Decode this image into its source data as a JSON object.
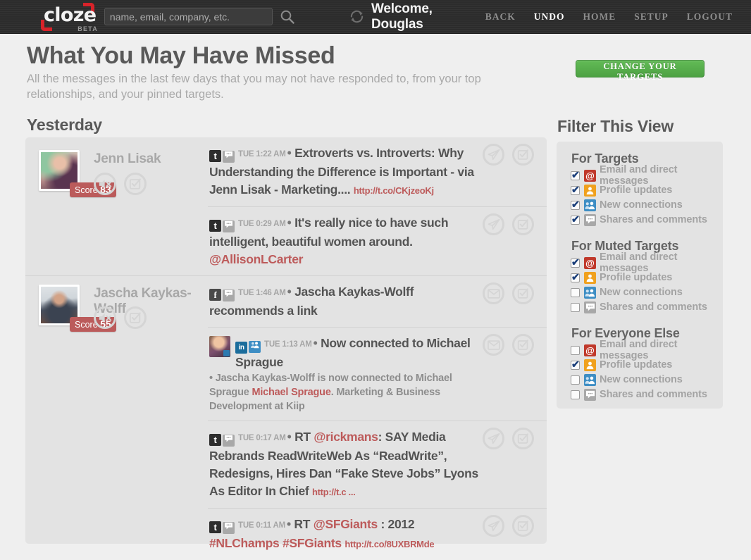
{
  "topbar": {
    "logo": "cloze",
    "logo_beta": "BETA",
    "search_placeholder": "name, email, company, etc.",
    "search_value": "",
    "welcome": "Welcome, Douglas",
    "nav": [
      {
        "label": "BACK",
        "active": false
      },
      {
        "label": "UNDO",
        "active": true
      },
      {
        "label": "HOME",
        "active": false
      },
      {
        "label": "SETUP",
        "active": false
      },
      {
        "label": "LOGOUT",
        "active": false
      }
    ]
  },
  "page": {
    "title": "What You May Have Missed",
    "subtitle": "All the messages in the last few days that you may not have responded to, from your top relationships, and your pinned targets.",
    "section_label": "Yesterday",
    "change_targets_button": "CHANGE YOUR TARGETS"
  },
  "filter": {
    "title": "Filter This View",
    "groups": [
      {
        "title": "For Targets",
        "rows": [
          {
            "label": "Email and direct messages",
            "icon": "at-icon",
            "glyph": "@",
            "checked": true
          },
          {
            "label": "Profile updates",
            "icon": "person-icon",
            "glyph": "♟",
            "checked": true
          },
          {
            "label": "New connections",
            "icon": "people-icon",
            "glyph": "♟",
            "checked": true
          },
          {
            "label": "Shares and comments",
            "icon": "chat-icon",
            "glyph": "●●",
            "checked": true
          }
        ]
      },
      {
        "title": "For Muted Targets",
        "rows": [
          {
            "label": "Email and direct messages",
            "icon": "at-icon",
            "glyph": "@",
            "checked": true
          },
          {
            "label": "Profile updates",
            "icon": "person-icon",
            "glyph": "♟",
            "checked": true
          },
          {
            "label": "New connections",
            "icon": "people-icon",
            "glyph": "♟",
            "checked": false
          },
          {
            "label": "Shares and comments",
            "icon": "chat-icon",
            "glyph": "●●",
            "checked": false
          }
        ]
      },
      {
        "title": "For Everyone Else",
        "rows": [
          {
            "label": "Email and direct messages",
            "icon": "at-icon",
            "glyph": "@",
            "checked": false
          },
          {
            "label": "Profile updates",
            "icon": "person-icon",
            "glyph": "♟",
            "checked": true
          },
          {
            "label": "New connections",
            "icon": "people-icon",
            "glyph": "♟",
            "checked": false
          },
          {
            "label": "Shares and comments",
            "icon": "chat-icon",
            "glyph": "●●",
            "checked": false
          }
        ]
      }
    ]
  },
  "feed": {
    "people": [
      {
        "name": "Jenn Lisak",
        "score_label": "Score",
        "score": "83",
        "messages": [
          {
            "source": "twitter",
            "source_glyph": "t",
            "type_icon": "chat-icon",
            "timestamp": "TUE 1:22 AM",
            "text": "Extroverts vs. Introverts: Why Understanding the Difference is Important - via Jenn Lisak - Marketing....",
            "link": "http://t.co/CKjzeoKj",
            "action": "send"
          },
          {
            "source": "twitter",
            "source_glyph": "t",
            "type_icon": "chat-icon",
            "timestamp": "TUE 0:29 AM",
            "text": "It's really nice to have such intelligent, beautiful women around.",
            "link": "@AllisonLCarter",
            "action": "send"
          }
        ]
      },
      {
        "name": "Jascha Kaykas-Wolff",
        "score_label": "Score",
        "score": "55",
        "messages": [
          {
            "source": "facebook",
            "source_glyph": "f",
            "type_icon": "chat-icon",
            "timestamp": "TUE 1:46 AM",
            "text": "Jascha Kaykas-Wolff recommends a link",
            "link": "",
            "action": "mail"
          },
          {
            "source": "linkedin",
            "source_glyph": "in",
            "type_icon": "people-icon",
            "timestamp": "TUE 1:13 AM",
            "text": "Now connected to Michael Sprague",
            "link": "",
            "action": "mail",
            "has_avatar": true,
            "sub_prefix": "• Jascha Kaykas-Wolff is now connected to Michael Sprague ",
            "sub_link": "Michael Sprague",
            "sub_suffix": ". Marketing & Business Development at Kiip"
          },
          {
            "source": "twitter",
            "source_glyph": "t",
            "type_icon": "chat-icon",
            "timestamp": "TUE 0:17 AM",
            "text_pre": "RT ",
            "mention": "@rickmans",
            "text": ": SAY Media Rebrands ReadWriteWeb As “ReadWrite”, Redesigns, Hires Dan “Fake Steve Jobs” Lyons As Editor In Chief",
            "link": "http://t.c ...",
            "action": "send"
          },
          {
            "source": "twitter",
            "source_glyph": "t",
            "type_icon": "chat-icon",
            "timestamp": "TUE 0:11 AM",
            "text_pre": "RT ",
            "mention": "@SFGiants",
            "text": " : 2012 ",
            "hashtag1": "#NLChamps",
            "hashtag2": "#SFGiants",
            "link": "http://t.co/8UXBRMde",
            "action": "send"
          }
        ]
      }
    ]
  },
  "colors": {
    "accent_red": "#c0392b",
    "brand_red": "#d8232a",
    "green_button": "#4da143",
    "link_red": "#bd5b5b",
    "score_badge": "#bb5b5b"
  }
}
